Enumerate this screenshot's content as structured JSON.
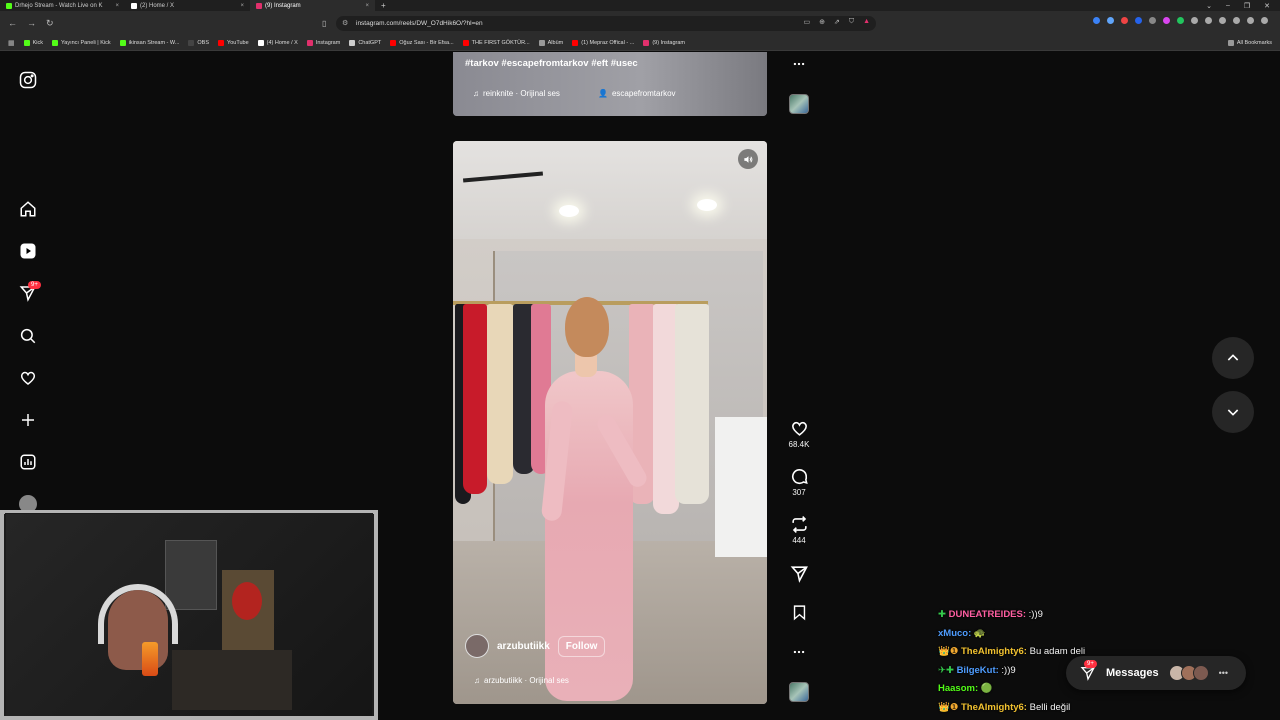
{
  "browser": {
    "tabs": [
      {
        "label": "Drhejo Stream - Watch Live on K",
        "color": "#53fc18",
        "active": false
      },
      {
        "label": "(2) Home / X",
        "color": "#ffffff",
        "active": false
      },
      {
        "label": "(9) Instagram",
        "color": "#e1306c",
        "active": true
      }
    ],
    "new_tab": "+",
    "url": "instagram.com/reels/DW_O7dHik6O/?hl=en",
    "bookmarks": [
      {
        "label": "Kick",
        "color": "#53fc18"
      },
      {
        "label": "Yayıncı Paneli | Kick",
        "color": "#53fc18"
      },
      {
        "label": "ikinsan Stream - W...",
        "color": "#53fc18"
      },
      {
        "label": "OBS",
        "color": "#444444"
      },
      {
        "label": "YouTube",
        "color": "#ff0000"
      },
      {
        "label": "(4) Home / X",
        "color": "#ffffff"
      },
      {
        "label": "Instagram",
        "color": "#e1306c"
      },
      {
        "label": "ChatGPT",
        "color": "#cccccc"
      },
      {
        "label": "Oğuz Sası - Bir Efsa...",
        "color": "#ff0000"
      },
      {
        "label": "THE FIRST GÖKTÜR...",
        "color": "#ff0000"
      },
      {
        "label": "Albüm",
        "color": "#999999"
      },
      {
        "label": "(1) Mepraz Offical - ...",
        "color": "#ff0000"
      },
      {
        "label": "(9) Instagram",
        "color": "#e1306c"
      }
    ],
    "all_bookmarks": "All Bookmarks"
  },
  "sidebar": {
    "notification_badge": "9+"
  },
  "reel_previous": {
    "caption": "#tarkov #escapefromtarkov #eft #usec",
    "audio": "reinknite · Orijinal ses",
    "collaborator": "escapefromtarkov"
  },
  "reel_current": {
    "username": "arzubutiikk",
    "follow_label": "Follow",
    "audio": "arzubutiikk · Orijinal ses",
    "likes": "68.4K",
    "comments": "307",
    "reposts": "444"
  },
  "messages": {
    "label": "Messages",
    "badge": "9+"
  },
  "chat": [
    {
      "prefix": "✚ ",
      "name": "DUNEATREIDES:",
      "name_color": "#ff5fa2",
      "prefix_color": "#34c94b",
      "text": " :))9"
    },
    {
      "prefix": "",
      "name": "xMuco:",
      "name_color": "#4f9dff",
      "prefix_color": "#ffffff",
      "text": " 🐢"
    },
    {
      "prefix": "👑❶ ",
      "name": "TheAlmighty6:",
      "name_color": "#f2c230",
      "prefix_color": "#f2a930",
      "text": " Bu adam deli"
    },
    {
      "prefix": "✈✚ ",
      "name": "BilgeKut:",
      "name_color": "#4f9dff",
      "prefix_color": "#34c94b",
      "text": " :))9"
    },
    {
      "prefix": "",
      "name": "Haasom:",
      "name_color": "#53fc18",
      "prefix_color": "#ffffff",
      "text": " 🟢"
    },
    {
      "prefix": "👑❶ ",
      "name": "TheAlmighty6:",
      "name_color": "#f2c230",
      "prefix_color": "#f2a930",
      "text": " Belli değil"
    }
  ]
}
